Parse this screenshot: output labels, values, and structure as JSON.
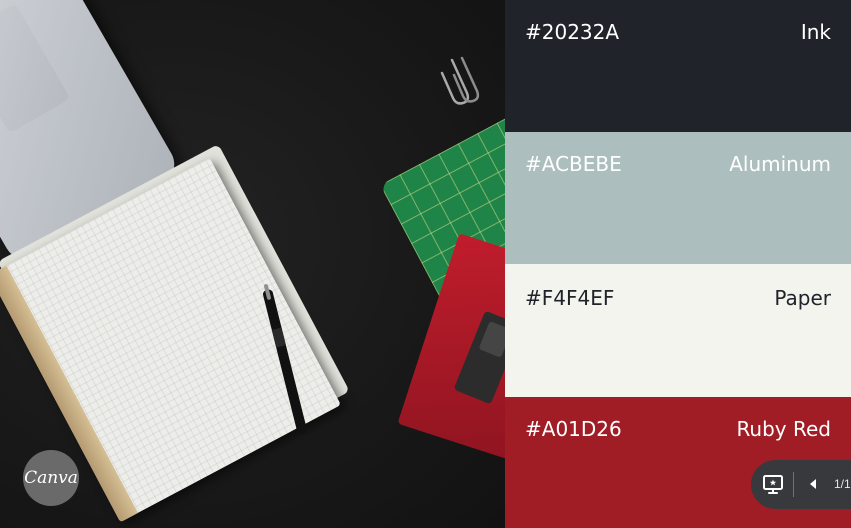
{
  "photo": {
    "brand_badge": {
      "text": "Canva",
      "color": "#6A6A6A"
    }
  },
  "palette": {
    "swatches": [
      {
        "hex": "#20232A",
        "name": "Ink",
        "color": "#20232A",
        "text_color": "#FFFFFF"
      },
      {
        "hex": "#ACBEBE",
        "name": "Aluminum",
        "color": "#ACBEBE",
        "text_color": "#FFFFFF"
      },
      {
        "hex": "#F4F4EF",
        "name": "Paper",
        "color": "#F4F4EF",
        "text_color": "#20232A"
      },
      {
        "hex": "#A01D26",
        "name": "Ruby Red",
        "color": "#A01D26",
        "text_color": "#FFFFFF"
      }
    ]
  },
  "presenter": {
    "present_icon": "present-screen-icon",
    "prev_icon": "caret-left-icon",
    "page_indicator": "1/1"
  }
}
